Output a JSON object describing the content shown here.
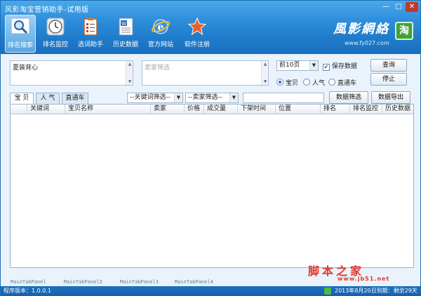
{
  "window": {
    "title": "风影淘宝营销助手-试用版",
    "minimize": "—",
    "maximize": "□",
    "close": "✕"
  },
  "toolbar": {
    "items": [
      {
        "label": "排名搜索",
        "icon": "magnifier-icon",
        "active": true
      },
      {
        "label": "排名监控",
        "icon": "clock-icon",
        "active": false
      },
      {
        "label": "选词助手",
        "icon": "clipboard-icon",
        "active": false
      },
      {
        "label": "历史数据",
        "icon": "document-icon",
        "active": false
      },
      {
        "label": "官方网站",
        "icon": "ie-browser-icon",
        "active": false
      },
      {
        "label": "软件注册",
        "icon": "star-icon",
        "active": false
      }
    ]
  },
  "brand": {
    "logo_text": "風影網絡",
    "url": "www.fy027.com",
    "badge": "淘"
  },
  "search": {
    "keyword_value": "夏装背心",
    "seller_filter_placeholder": "卖家筛选",
    "pages_select": "前10页",
    "save_data_label": "保存数据",
    "save_data_checked": true,
    "radio_options": [
      {
        "label": "宝贝",
        "selected": true
      },
      {
        "label": "人气",
        "selected": false
      },
      {
        "label": "直通车",
        "selected": false
      }
    ],
    "query_button": "查询",
    "stop_button": "停止"
  },
  "tabs": [
    {
      "label": "宝 贝",
      "active": true
    },
    {
      "label": "人 气",
      "active": false
    },
    {
      "label": "直通车",
      "active": false
    }
  ],
  "filters": {
    "keyword_filter": "--关键词筛选--",
    "seller_filter": "--卖家筛选--",
    "filter_text_value": "",
    "data_filter_button": "数据筛选",
    "data_export_button": "数据导出"
  },
  "grid": {
    "columns": [
      "关键词",
      "宝贝名称",
      "卖家",
      "价格",
      "成交量",
      "下架时间",
      "位置",
      "排名",
      "排名监控",
      "历史数据"
    ],
    "rows": []
  },
  "bottom_tabs": [
    "MainTabPanel",
    "MainTabPanel2",
    "MainTabPanel3",
    "MainTabPanel4"
  ],
  "watermark": {
    "text": "脚本之家",
    "url": "www.jb51.net"
  },
  "status": {
    "version": "程序版本：1.0.0.1",
    "expiry": "2013年8月20日到期：剩余29天"
  }
}
